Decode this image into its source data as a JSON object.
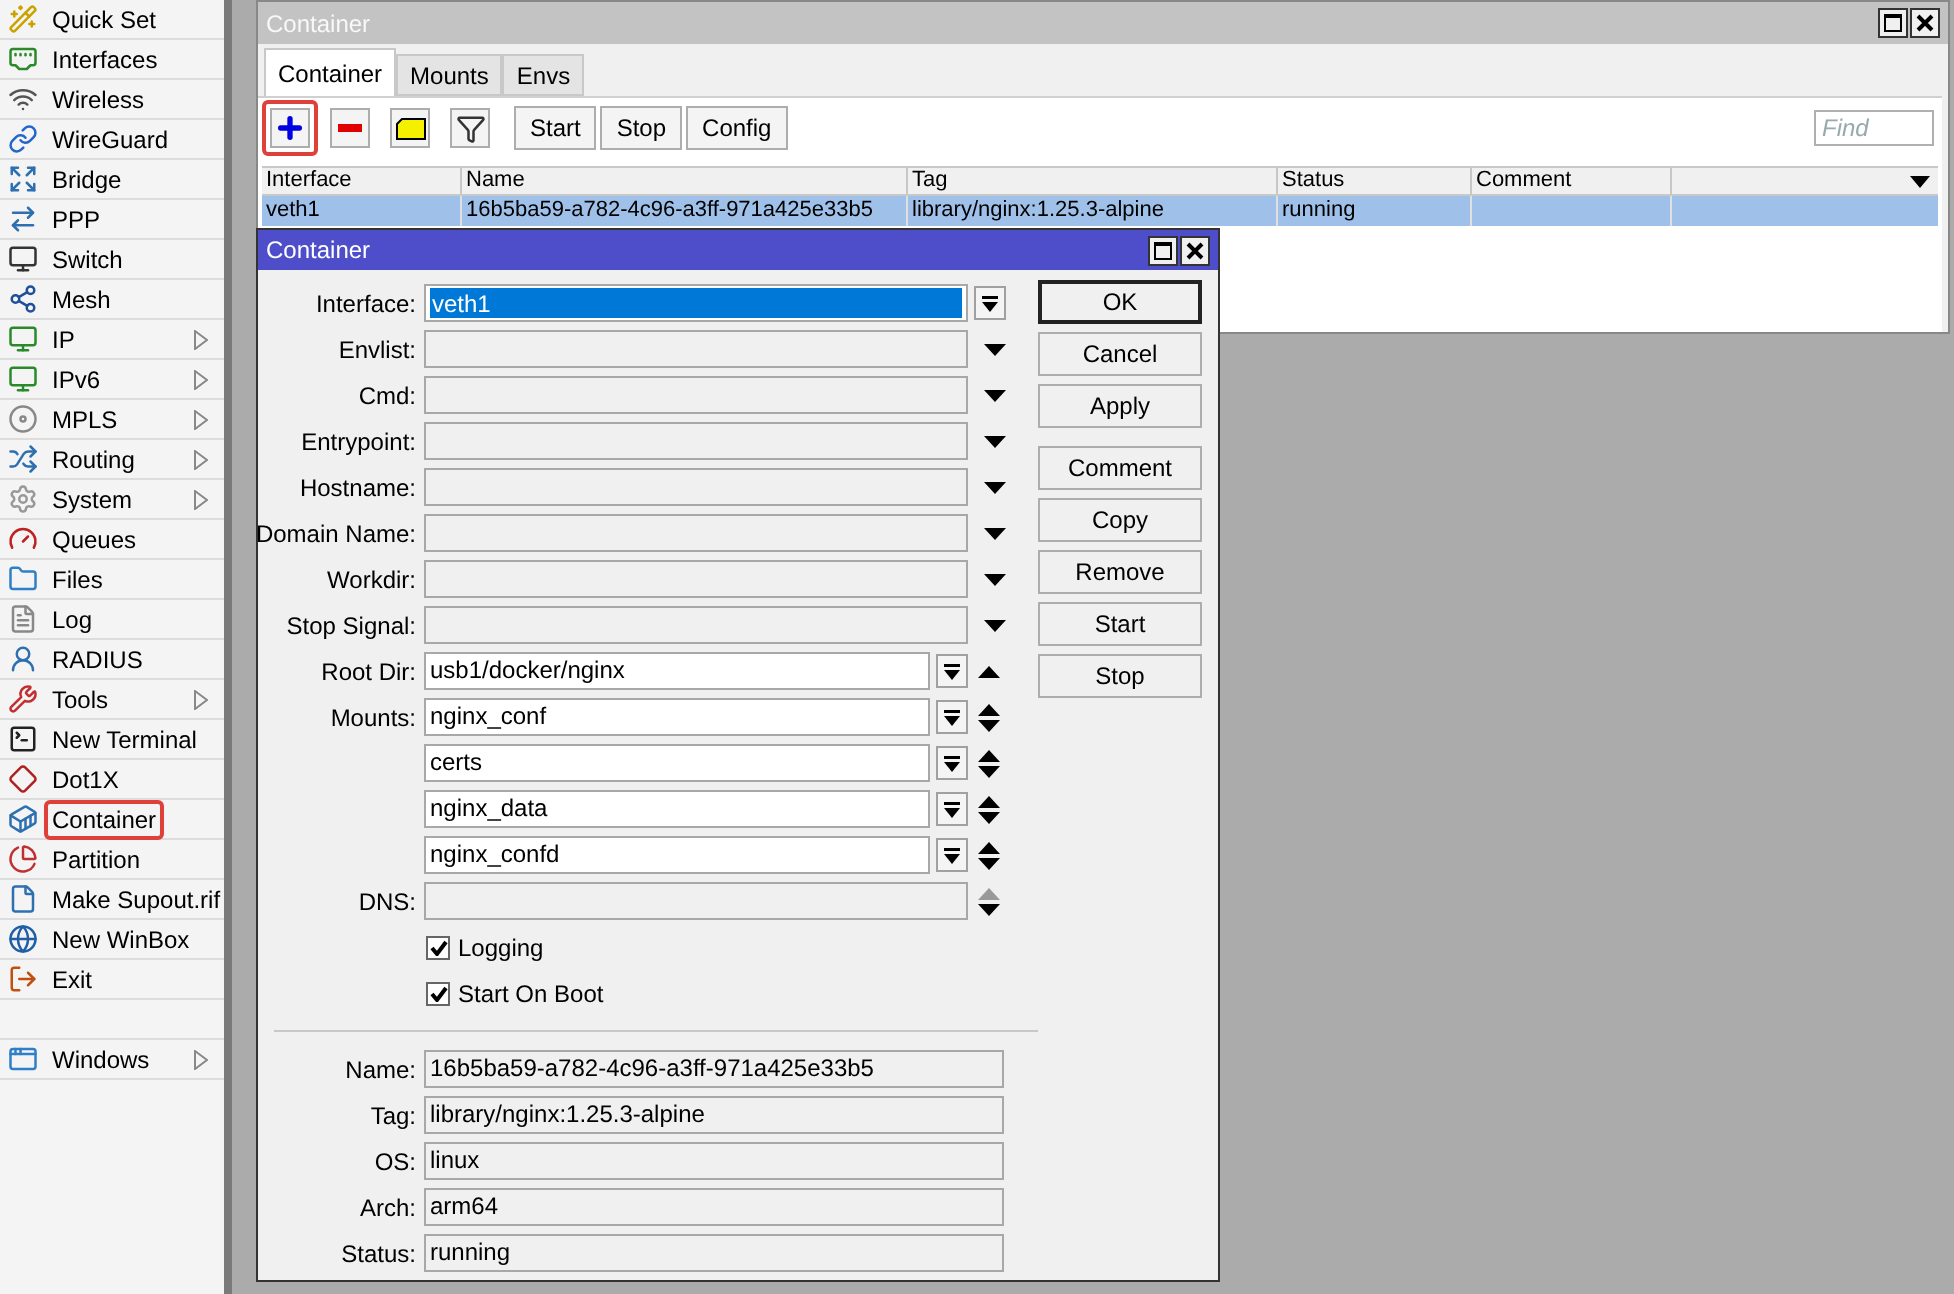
{
  "sidebar": {
    "items": [
      {
        "label": "Quick Set",
        "submenu": false,
        "highlighted": false
      },
      {
        "label": "Interfaces",
        "submenu": false,
        "highlighted": false
      },
      {
        "label": "Wireless",
        "submenu": false,
        "highlighted": false
      },
      {
        "label": "WireGuard",
        "submenu": false,
        "highlighted": false
      },
      {
        "label": "Bridge",
        "submenu": false,
        "highlighted": false
      },
      {
        "label": "PPP",
        "submenu": false,
        "highlighted": false
      },
      {
        "label": "Switch",
        "submenu": false,
        "highlighted": false
      },
      {
        "label": "Mesh",
        "submenu": false,
        "highlighted": false
      },
      {
        "label": "IP",
        "submenu": true,
        "highlighted": false
      },
      {
        "label": "IPv6",
        "submenu": true,
        "highlighted": false
      },
      {
        "label": "MPLS",
        "submenu": true,
        "highlighted": false
      },
      {
        "label": "Routing",
        "submenu": true,
        "highlighted": false
      },
      {
        "label": "System",
        "submenu": true,
        "highlighted": false
      },
      {
        "label": "Queues",
        "submenu": false,
        "highlighted": false
      },
      {
        "label": "Files",
        "submenu": false,
        "highlighted": false
      },
      {
        "label": "Log",
        "submenu": false,
        "highlighted": false
      },
      {
        "label": "RADIUS",
        "submenu": false,
        "highlighted": false
      },
      {
        "label": "Tools",
        "submenu": true,
        "highlighted": false
      },
      {
        "label": "New Terminal",
        "submenu": false,
        "highlighted": false
      },
      {
        "label": "Dot1X",
        "submenu": false,
        "highlighted": false
      },
      {
        "label": "Container",
        "submenu": false,
        "highlighted": true
      },
      {
        "label": "Partition",
        "submenu": false,
        "highlighted": false
      },
      {
        "label": "Make Supout.rif",
        "submenu": false,
        "highlighted": false
      },
      {
        "label": "New WinBox",
        "submenu": false,
        "highlighted": false
      },
      {
        "label": "Exit",
        "submenu": false,
        "highlighted": false
      }
    ],
    "bottom_items": [
      {
        "label": "Windows",
        "submenu": true,
        "highlighted": false
      }
    ]
  },
  "main_window": {
    "title": "Container",
    "tabs": [
      {
        "label": "Container",
        "selected": true
      },
      {
        "label": "Mounts",
        "selected": false
      },
      {
        "label": "Envs",
        "selected": false
      }
    ],
    "toolbar": {
      "icon_buttons": [
        {
          "kind": "add",
          "highlighted": true
        },
        {
          "kind": "remove",
          "highlighted": false
        },
        {
          "kind": "comment",
          "highlighted": false
        },
        {
          "kind": "filter",
          "highlighted": false
        }
      ],
      "buttons": [
        "Start",
        "Stop",
        "Config"
      ],
      "find": {
        "placeholder": "Find"
      }
    },
    "table": {
      "columns": [
        "Interface",
        "Name",
        "Tag",
        "Status",
        "Comment"
      ],
      "rows": [
        {
          "cells": [
            "veth1",
            "16b5ba59-a782-4c96-a3ff-971a425e33b5",
            "library/nginx:1.25.3-alpine",
            "running"
          ],
          "selected": true
        }
      ]
    }
  },
  "dialog": {
    "title": "Container",
    "fields": [
      {
        "kind": "combo",
        "label": "Interface:",
        "value": "veth1",
        "selected": true
      },
      {
        "kind": "unset",
        "label": "Envlist:"
      },
      {
        "kind": "unset",
        "label": "Cmd:"
      },
      {
        "kind": "unset",
        "label": "Entrypoint:"
      },
      {
        "kind": "unset",
        "label": "Hostname:"
      },
      {
        "kind": "unset",
        "label": "Domain Name:"
      },
      {
        "kind": "unset",
        "label": "Workdir:"
      },
      {
        "kind": "unset",
        "label": "Stop Signal:"
      },
      {
        "kind": "single",
        "label": "Root Dir:",
        "value": "usb1/docker/nginx"
      },
      {
        "kind": "list",
        "label": "Mounts:",
        "values": [
          "nginx_conf",
          "certs",
          "nginx_data",
          "nginx_confd"
        ]
      },
      {
        "kind": "empty_list",
        "label": "DNS:"
      },
      {
        "kind": "checkbox",
        "label": "Logging",
        "checked": true
      },
      {
        "kind": "checkbox",
        "label": "Start On Boot",
        "checked": true
      }
    ],
    "status": [
      {
        "label": "Name:",
        "value": "16b5ba59-a782-4c96-a3ff-971a425e33b5"
      },
      {
        "label": "Tag:",
        "value": "library/nginx:1.25.3-alpine"
      },
      {
        "label": "OS:",
        "value": "linux"
      },
      {
        "label": "Arch:",
        "value": "arm64"
      },
      {
        "label": "Status:",
        "value": "running"
      }
    ],
    "button_groups": [
      [
        {
          "label": "OK",
          "default": true
        },
        {
          "label": "Cancel",
          "default": false
        },
        {
          "label": "Apply",
          "default": false
        }
      ],
      [
        {
          "label": "Comment",
          "default": false
        },
        {
          "label": "Copy",
          "default": false
        },
        {
          "label": "Remove",
          "default": false
        },
        {
          "label": "Start",
          "default": false
        },
        {
          "label": "Stop",
          "default": false
        }
      ]
    ]
  }
}
